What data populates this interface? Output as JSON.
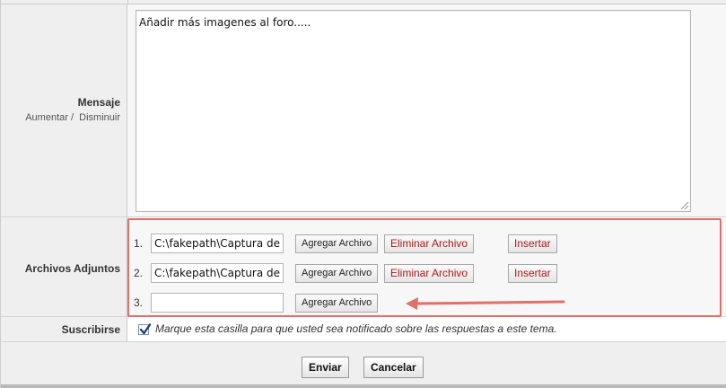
{
  "message": {
    "label": "Mensaje",
    "increase_label": "Aumentar /",
    "decrease_label": "Disminuir",
    "text": "Añadir más imagenes al foro....."
  },
  "attachments": {
    "label": "Archivos Adjuntos",
    "rows": [
      {
        "number": "1.",
        "file_value": "C:\\fakepath\\Captura de p",
        "add_label": "Agregar Archivo",
        "delete_label": "Eliminar Archivo",
        "insert_label": "Insertar"
      },
      {
        "number": "2.",
        "file_value": "C:\\fakepath\\Captura de p",
        "add_label": "Agregar Archivo",
        "delete_label": "Eliminar Archivo",
        "insert_label": "Insertar"
      },
      {
        "number": "3.",
        "file_value": "",
        "add_label": "Agregar Archivo"
      }
    ],
    "highlight_color": "#e0706a"
  },
  "subscribe": {
    "label": "Suscribirse",
    "checked": true,
    "text": "Marque esta casilla para que usted sea notificado sobre las respuestas a este tema."
  },
  "footer": {
    "submit_label": "Enviar",
    "cancel_label": "Cancelar"
  },
  "colors": {
    "label_bg": "#efefef",
    "danger_text": "#b01818",
    "annotation_arrow": "#e0706a"
  }
}
